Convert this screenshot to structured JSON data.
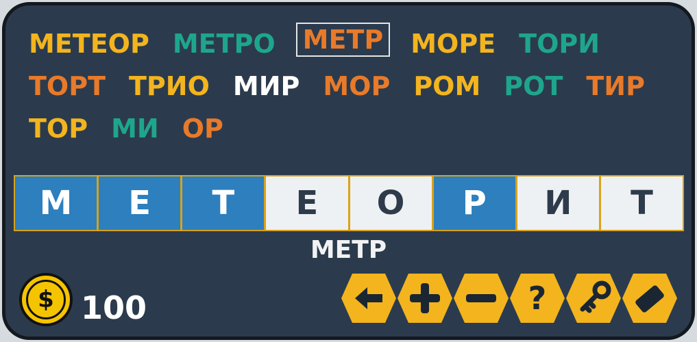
{
  "words": [
    {
      "text": "МЕТЕОР",
      "color": "#f3b41e"
    },
    {
      "text": "МЕТРО",
      "color": "#1ea68d"
    },
    {
      "text": "МЕТР",
      "color": "#e87a2a",
      "selected": true
    },
    {
      "text": "МОРЕ",
      "color": "#f3b41e"
    },
    {
      "text": "ТОРИ",
      "color": "#1ea68d"
    },
    {
      "text": "ТОРТ",
      "color": "#e87a2a"
    },
    {
      "text": "ТРИО",
      "color": "#f3b41e"
    },
    {
      "text": "МИР",
      "color": "#ffffff"
    },
    {
      "text": "МОР",
      "color": "#e87a2a"
    },
    {
      "text": "РОМ",
      "color": "#f3b41e"
    },
    {
      "text": "РОТ",
      "color": "#1ea68d"
    },
    {
      "text": "ТИР",
      "color": "#e87a2a"
    },
    {
      "text": "ТОР",
      "color": "#f3b41e"
    },
    {
      "text": "МИ",
      "color": "#1ea68d"
    },
    {
      "text": "ОР",
      "color": "#e87a2a"
    }
  ],
  "tiles": [
    {
      "letter": "М",
      "active": true
    },
    {
      "letter": "Е",
      "active": true
    },
    {
      "letter": "Т",
      "active": true
    },
    {
      "letter": "Е",
      "active": false
    },
    {
      "letter": "О",
      "active": false
    },
    {
      "letter": "Р",
      "active": true
    },
    {
      "letter": "И",
      "active": false
    },
    {
      "letter": "Т",
      "active": false
    }
  ],
  "current_word": "МЕТР",
  "coin": {
    "symbol": "$",
    "count": "100"
  },
  "tools": [
    {
      "name": "back-arrow-icon"
    },
    {
      "name": "plus-icon"
    },
    {
      "name": "minus-icon"
    },
    {
      "name": "question-icon"
    },
    {
      "name": "key-icon"
    },
    {
      "name": "eraser-icon"
    }
  ],
  "colors": {
    "background": "#2b3b4d",
    "tile_active": "#2d7fbd",
    "tile_inactive": "#eef1f3",
    "tile_border": "#d9a31a",
    "tool": "#f3b41e"
  }
}
